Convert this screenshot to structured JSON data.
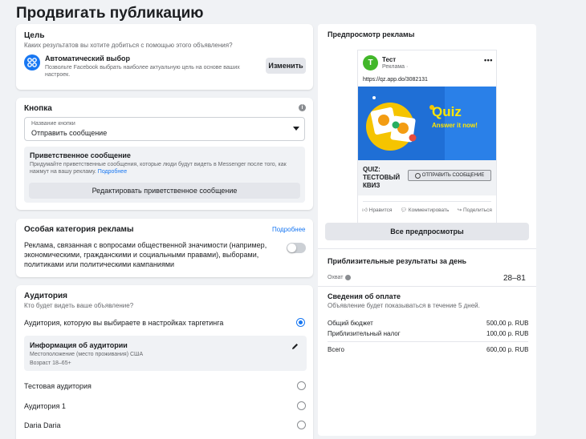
{
  "page": {
    "title": "Продвигать публикацию"
  },
  "goal": {
    "title": "Цель",
    "subtitle": "Каких результатов вы хотите добиться с помощью этого объявления?",
    "option_name": "Автоматический выбор",
    "option_desc": "Позвольте Facebook выбрать наиболее актуальную цель на основе ваших настроек.",
    "change_label": "Изменить"
  },
  "button_section": {
    "title": "Кнопка",
    "select_label": "Название кнопки",
    "select_value": "Отправить сообщение",
    "welcome_title": "Приветственное сообщение",
    "welcome_desc": "Придумайте приветственные сообщения, которые люди будут видеть в Messenger после того, как нажмут на вашу рекламу.",
    "welcome_more": "Подробнее",
    "edit_welcome_label": "Редактировать приветственное сообщение"
  },
  "special_category": {
    "title": "Особая категория рекламы",
    "more_link": "Подробнее",
    "desc": "Реклама, связанная с вопросами общественной значимости (например, экономическими, гражданскими и социальными правами), выборами, политиками или политическими кампаниями",
    "toggle_on": false
  },
  "audience": {
    "title": "Аудитория",
    "subtitle": "Кто будет видеть ваше объявление?",
    "targeting_option": "Аудитория, которую вы выбираете в настройках таргетинга",
    "info_title": "Информация об аудитории",
    "info_location": "Местоположение (место проживания) США",
    "info_age": "Возраст 18–65+",
    "options": [
      "Тестовая аудитория",
      "Аудитория 1",
      "Daria Daria"
    ]
  },
  "preview": {
    "title": "Предпросмотр рекламы",
    "page_initial": "T",
    "page_name": "Тест",
    "sponsored": "Реклама · ",
    "url": "https://qz.app.do/3082131",
    "image_title": "Quiz",
    "image_subtitle": "Answer it now!",
    "footer_title": "QUIZ: ТЕСТОВЫЙ КВИЗ",
    "cta_label": "ОТПРАВИТЬ СООБЩЕНИЕ",
    "like": "Нравится",
    "comment": "Комментировать",
    "share": "Поделиться",
    "all_previews": "Все предпросмотры"
  },
  "results": {
    "title": "Приблизительные результаты за день",
    "reach_label": "Охват",
    "reach_value": "28–81"
  },
  "payment": {
    "title": "Сведения об оплате",
    "subtitle": "Объявление будет показываться в течение 5 дней.",
    "budget_label": "Общий бюджет",
    "budget_value": "500,00 р. RUB",
    "tax_label": "Приблизительный налог",
    "tax_value": "100,00 р. RUB",
    "total_label": "Всего",
    "total_value": "600,00 р. RUB"
  },
  "colors": {
    "accent": "#1877f2",
    "page_bg": "#f0f2f5",
    "avatar": "#42b72a",
    "ad_image": "#1f6fd6"
  }
}
